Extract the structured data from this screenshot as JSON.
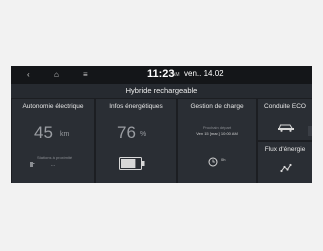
{
  "header": {
    "back": "‹",
    "home": "⌂",
    "menu": "≡",
    "time": "11:23",
    "ampm": "AM",
    "date": "ven.. 14.02"
  },
  "title": "Hybride rechargeable",
  "cards": {
    "autonomie": {
      "title": "Autonomie électrique",
      "value": "45",
      "unit": "km",
      "note": "Stations à proximité",
      "dots": "..."
    },
    "infos": {
      "title": "Infos énergétiques",
      "value": "76",
      "unit": "%",
      "battery_level": 0.76
    },
    "charge": {
      "title": "Gestion de charge",
      "line1": "Prochain départ",
      "line2": "Ven 15 [mar.] 10:00 AM",
      "timer": "0h"
    },
    "eco": {
      "title": "Conduite ECO"
    },
    "flux": {
      "title": "Flux d'énergie"
    }
  }
}
